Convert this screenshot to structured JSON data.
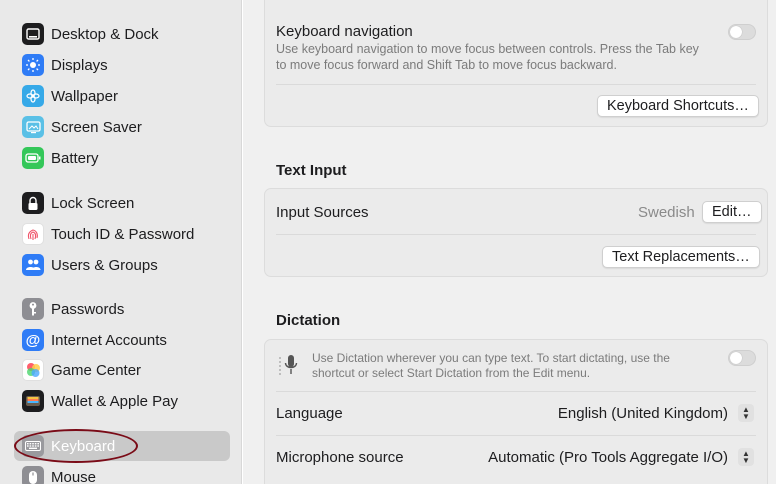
{
  "sidebar": {
    "items": [
      {
        "label": "Desktop & Dock",
        "icon": "desktop-dock-icon",
        "color": "#1d1d1f"
      },
      {
        "label": "Displays",
        "icon": "displays-icon",
        "color": "#2f7cf6"
      },
      {
        "label": "Wallpaper",
        "icon": "wallpaper-icon",
        "color": "#36a9e8"
      },
      {
        "label": "Screen Saver",
        "icon": "screen-saver-icon",
        "color": "#5ac0e6"
      },
      {
        "label": "Battery",
        "icon": "battery-icon",
        "color": "#34c759"
      },
      {
        "label": "Lock Screen",
        "icon": "lock-icon",
        "color": "#1d1d1f"
      },
      {
        "label": "Touch ID & Password",
        "icon": "fingerprint-icon",
        "color": "#ffffff"
      },
      {
        "label": "Users & Groups",
        "icon": "users-icon",
        "color": "#2f7cf6"
      },
      {
        "label": "Passwords",
        "icon": "key-icon",
        "color": "#8e8e93"
      },
      {
        "label": "Internet Accounts",
        "icon": "at-icon",
        "color": "#2f7cf6"
      },
      {
        "label": "Game Center",
        "icon": "game-center-icon",
        "color": "#ffffff"
      },
      {
        "label": "Wallet & Apple Pay",
        "icon": "wallet-icon",
        "color": "#1d1d1f"
      },
      {
        "label": "Keyboard",
        "icon": "keyboard-icon",
        "color": "#8e8e93"
      },
      {
        "label": "Mouse",
        "icon": "mouse-icon",
        "color": "#8e8e93"
      }
    ],
    "selected": "Keyboard"
  },
  "keyboard_nav": {
    "title": "Keyboard navigation",
    "description_line1": "Use keyboard navigation to move focus between controls. Press the Tab key",
    "description_line2": "to move focus forward and Shift Tab to move focus backward.",
    "enabled": false,
    "shortcuts_button": "Keyboard Shortcuts…"
  },
  "text_input": {
    "section_title": "Text Input",
    "input_sources_label": "Input Sources",
    "input_sources_value": "Swedish",
    "edit_button": "Edit…",
    "replacements_button": "Text Replacements…"
  },
  "dictation": {
    "section_title": "Dictation",
    "description_line1": "Use Dictation wherever you can type text. To start dictating, use the",
    "description_line2": "shortcut or select Start Dictation from the Edit menu.",
    "enabled": false,
    "language_label": "Language",
    "language_value": "English (United Kingdom)",
    "mic_label": "Microphone source",
    "mic_value": "Automatic (Pro Tools Aggregate I/O)"
  },
  "colors": {
    "annotation": "#7a0b17",
    "accent": "#2f7cf6"
  }
}
